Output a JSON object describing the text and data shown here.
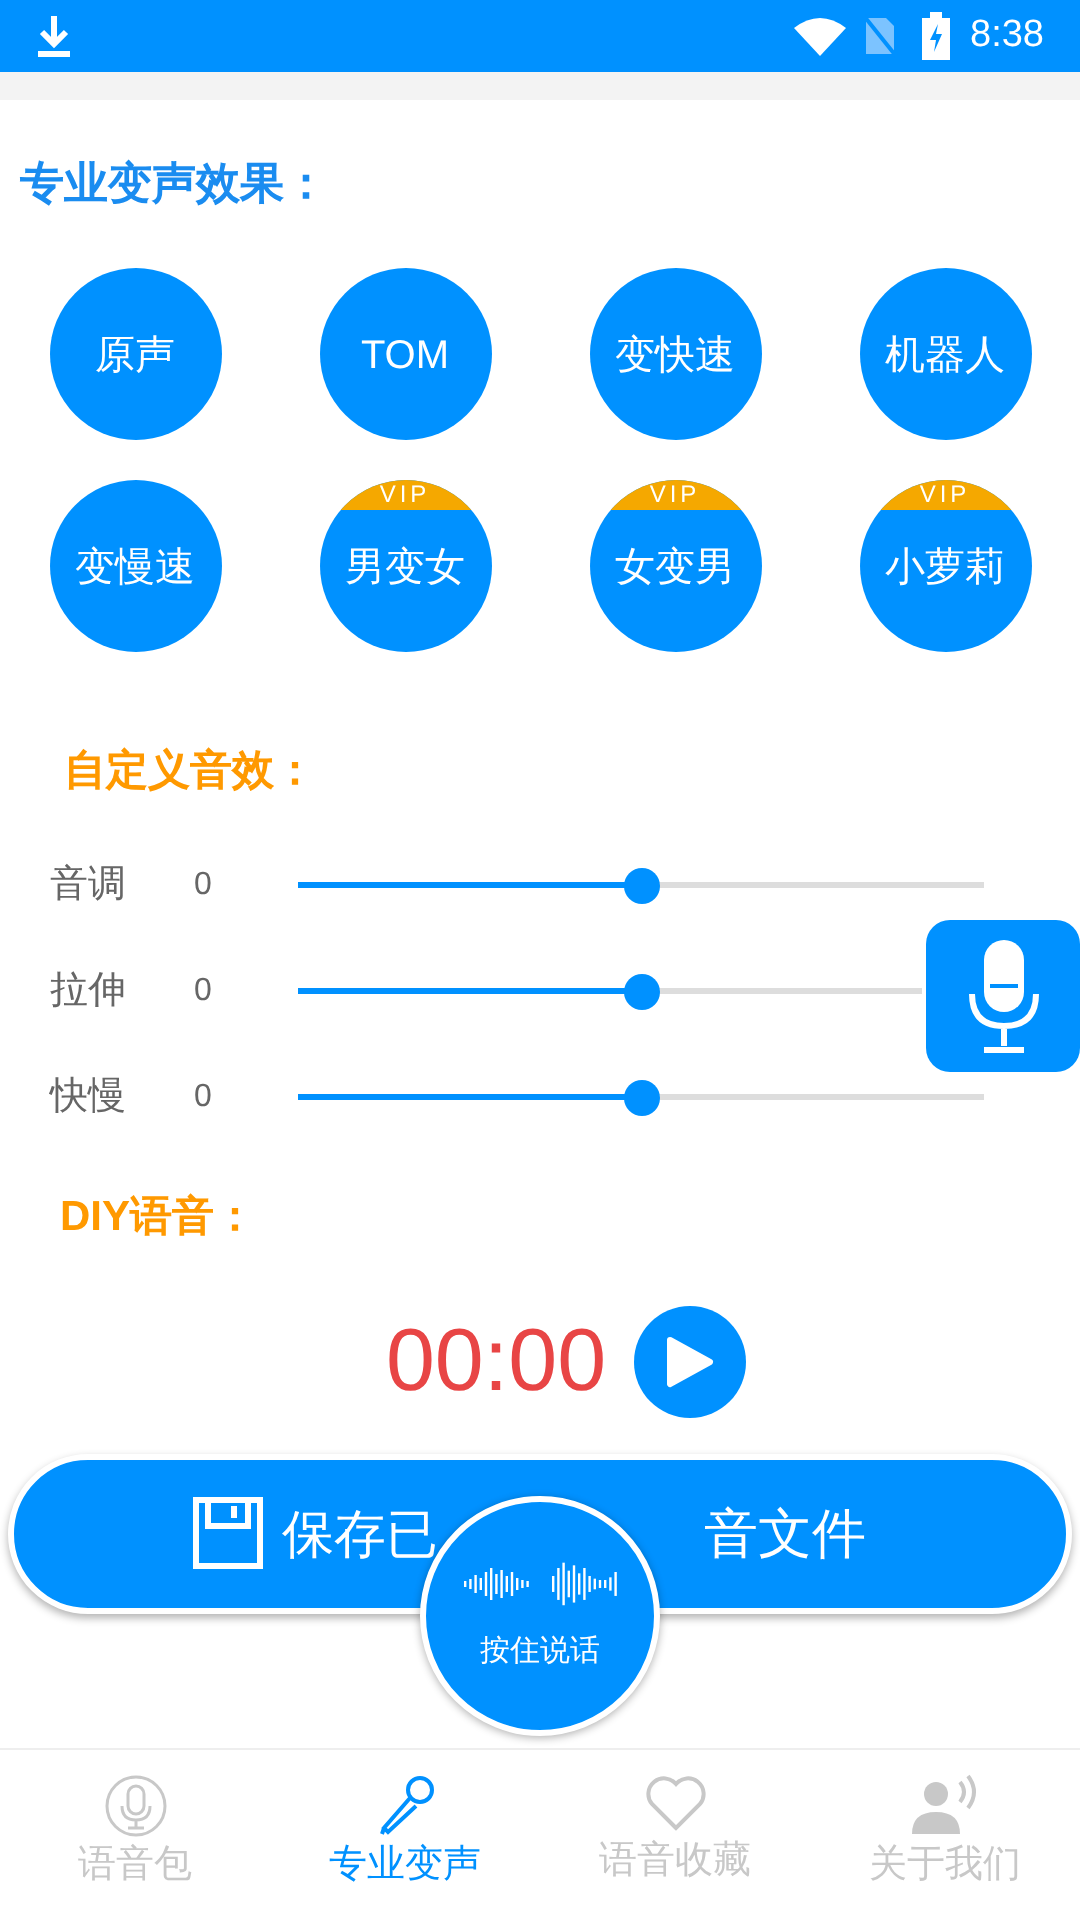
{
  "status_bar": {
    "time": "8:38"
  },
  "effects_title": "专业变声效果：",
  "effects": [
    {
      "label": "原声",
      "vip": false
    },
    {
      "label": "TOM",
      "vip": false
    },
    {
      "label": "变快速",
      "vip": false
    },
    {
      "label": "机器人",
      "vip": false
    },
    {
      "label": "变慢速",
      "vip": false
    },
    {
      "label": "男变女",
      "vip": true,
      "badge": "VIP"
    },
    {
      "label": "女变男",
      "vip": true,
      "badge": "VIP"
    },
    {
      "label": "小萝莉",
      "vip": true,
      "badge": "VIP"
    }
  ],
  "custom_title": "自定义音效：",
  "sliders": [
    {
      "label": "音调",
      "value": "0",
      "level": 0.5
    },
    {
      "label": "拉伸",
      "value": "0",
      "level": 0.5
    },
    {
      "label": "快慢",
      "value": "0",
      "level": 0.5
    }
  ],
  "diy_title": "DIY语音：",
  "timer": "00:00",
  "save_button": {
    "label_left": "保存已",
    "label_right": "音文件"
  },
  "hold_button": {
    "label": "按住说话"
  },
  "tabs": [
    {
      "label": "语音包",
      "selected": false
    },
    {
      "label": "专业变声",
      "selected": true
    },
    {
      "label": "语音收藏",
      "selected": false
    },
    {
      "label": "关于我们",
      "selected": false
    }
  ]
}
